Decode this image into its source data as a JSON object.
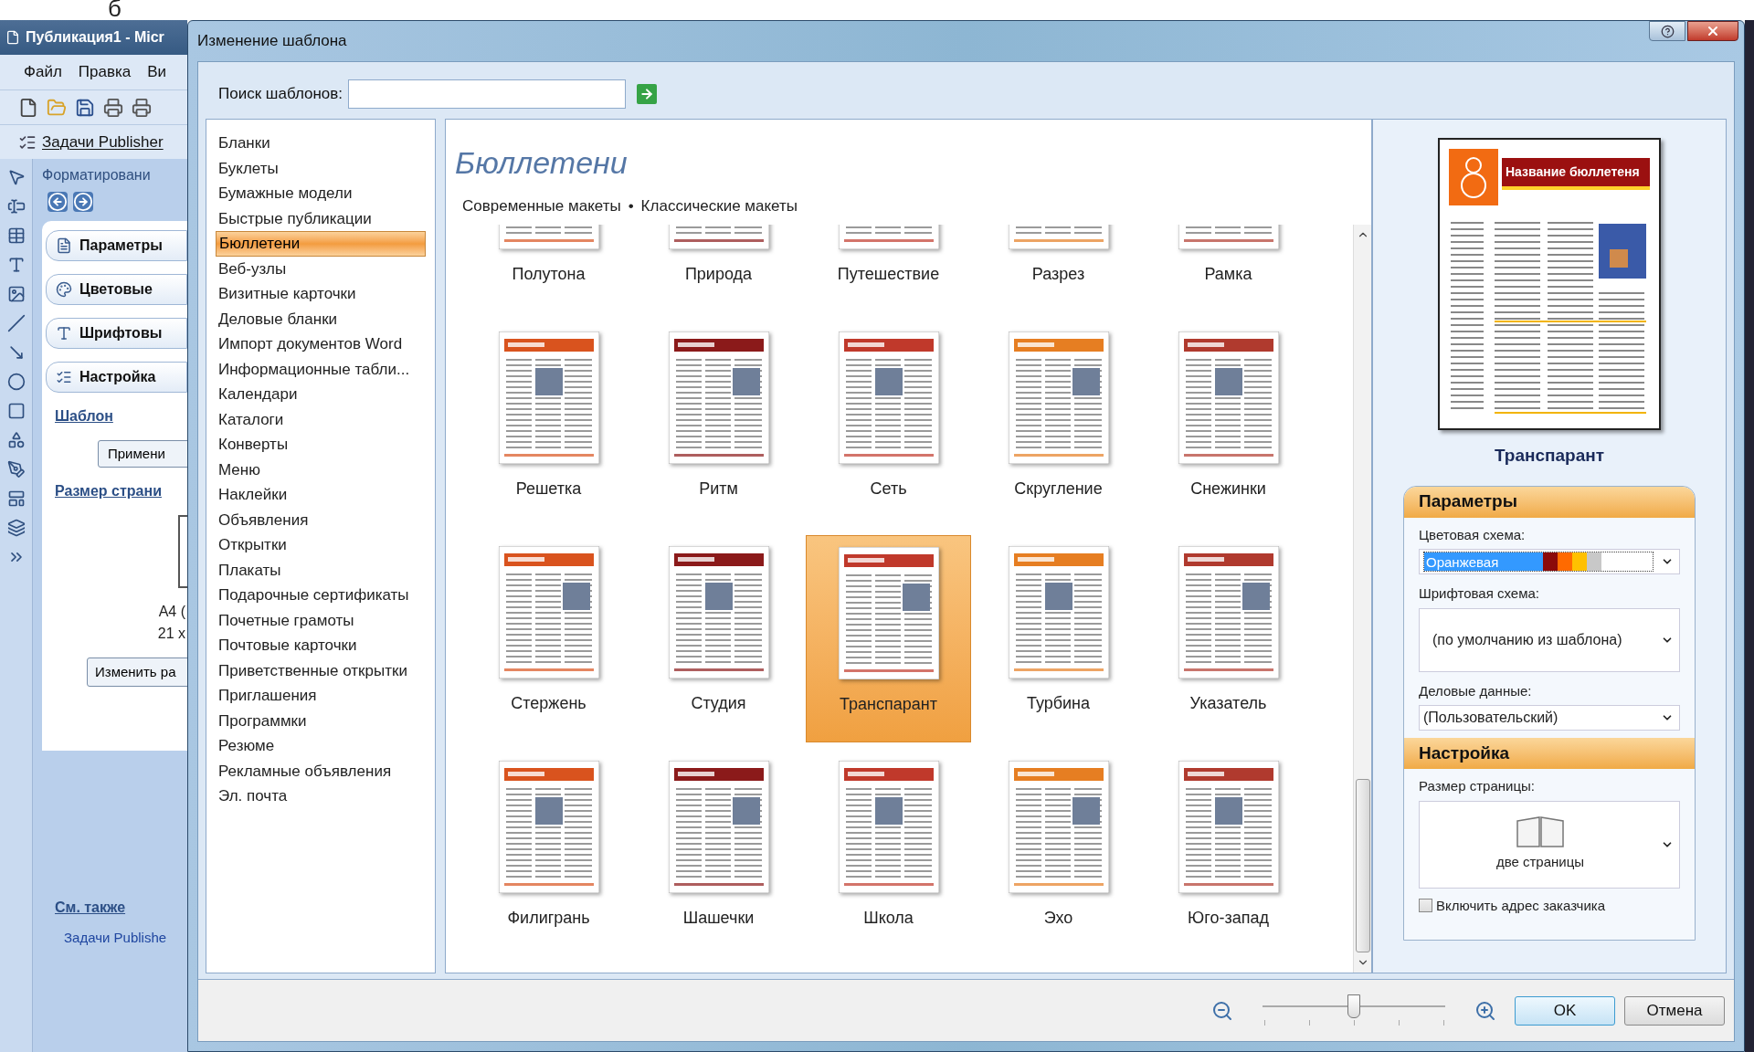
{
  "fragment": "б",
  "background_app": {
    "title": "Публикация1 - Micr",
    "menu": [
      "Файл",
      "Правка",
      "Ви"
    ],
    "task_toolbar": "Задачи Publisher",
    "task_pane": {
      "title": "Форматировани",
      "sections": [
        "Параметры",
        "Цветовые",
        "Шрифтовы",
        "Настройка"
      ],
      "template_heading": "Шаблон",
      "apply_button": "Примени",
      "page_size_heading": "Размер страни",
      "page_size_lines": [
        "А4 (",
        "21 х"
      ],
      "change_button": "Изменить ра",
      "see_also": "См. также",
      "see_also_link": "Задачи Publishe"
    }
  },
  "dialog": {
    "title": "Изменение шаблона",
    "search": {
      "label": "Поиск шаблонов:"
    },
    "categories": [
      {
        "label": "Бланки",
        "selected": false
      },
      {
        "label": "Буклеты",
        "selected": false
      },
      {
        "label": "Бумажные модели",
        "selected": false
      },
      {
        "label": "Быстрые публикации",
        "selected": false
      },
      {
        "label": "Бюллетени",
        "selected": true
      },
      {
        "label": "Веб-узлы",
        "selected": false
      },
      {
        "label": "Визитные карточки",
        "selected": false
      },
      {
        "label": "Деловые бланки",
        "selected": false
      },
      {
        "label": "Импорт документов Word",
        "selected": false
      },
      {
        "label": "Информационные табли...",
        "selected": false
      },
      {
        "label": "Календари",
        "selected": false
      },
      {
        "label": "Каталоги",
        "selected": false
      },
      {
        "label": "Конверты",
        "selected": false
      },
      {
        "label": "Меню",
        "selected": false
      },
      {
        "label": "Наклейки",
        "selected": false
      },
      {
        "label": "Объявления",
        "selected": false
      },
      {
        "label": "Открытки",
        "selected": false
      },
      {
        "label": "Плакаты",
        "selected": false
      },
      {
        "label": "Подарочные сертификаты",
        "selected": false
      },
      {
        "label": "Почетные грамоты",
        "selected": false
      },
      {
        "label": "Почтовые карточки",
        "selected": false
      },
      {
        "label": "Приветственные открытки",
        "selected": false
      },
      {
        "label": "Приглашения",
        "selected": false
      },
      {
        "label": "Программки",
        "selected": false
      },
      {
        "label": "Резюме",
        "selected": false
      },
      {
        "label": "Рекламные объявления",
        "selected": false
      },
      {
        "label": "Эл. почта",
        "selected": false
      }
    ],
    "gallery": {
      "heading": "Бюллетени",
      "layout_links": [
        "Современные макеты",
        "Классические макеты"
      ],
      "separator": "•",
      "templates": [
        {
          "name": "Полутона",
          "selected": false
        },
        {
          "name": "Природа",
          "selected": false
        },
        {
          "name": "Путешествие",
          "selected": false
        },
        {
          "name": "Разрез",
          "selected": false
        },
        {
          "name": "Рамка",
          "selected": false
        },
        {
          "name": "Решетка",
          "selected": false
        },
        {
          "name": "Ритм",
          "selected": false
        },
        {
          "name": "Сеть",
          "selected": false
        },
        {
          "name": "Скругление",
          "selected": false
        },
        {
          "name": "Снежинки",
          "selected": false
        },
        {
          "name": "Стержень",
          "selected": false
        },
        {
          "name": "Студия",
          "selected": false
        },
        {
          "name": "Транспарант",
          "selected": true
        },
        {
          "name": "Турбина",
          "selected": false
        },
        {
          "name": "Указатель",
          "selected": false
        },
        {
          "name": "Филигрань",
          "selected": false
        },
        {
          "name": "Шашечки",
          "selected": false
        },
        {
          "name": "Школа",
          "selected": false
        },
        {
          "name": "Эхо",
          "selected": false
        },
        {
          "name": "Юго-запад",
          "selected": false
        }
      ]
    },
    "preview": {
      "name": "Транспарант",
      "banner": "Название бюллетеня"
    },
    "options": {
      "title": "Параметры",
      "color_scheme": {
        "label": "Цветовая схема:",
        "value": "Оранжевая",
        "swatches": [
          {
            "color": "#8b0a0a"
          },
          {
            "color": "#ff6a00"
          },
          {
            "color": "#ffc000"
          },
          {
            "color": "#c8c8c8"
          }
        ]
      },
      "font_scheme": {
        "label": "Шрифтовая схема:",
        "value": "(по умолчанию из шаблона)"
      },
      "business_info": {
        "label": "Деловые данные:",
        "value": "(Пользовательский)"
      }
    },
    "customize": {
      "title": "Настройка",
      "page_size": {
        "label": "Размер страницы:",
        "value": "две страницы"
      },
      "include_address": {
        "label": "Включить адрес заказчика",
        "checked": false
      }
    },
    "zoom": {
      "level": 0.5
    },
    "buttons": [
      {
        "label": "OK",
        "kind": "default"
      },
      {
        "label": "Отмена",
        "kind": "normal"
      }
    ]
  }
}
